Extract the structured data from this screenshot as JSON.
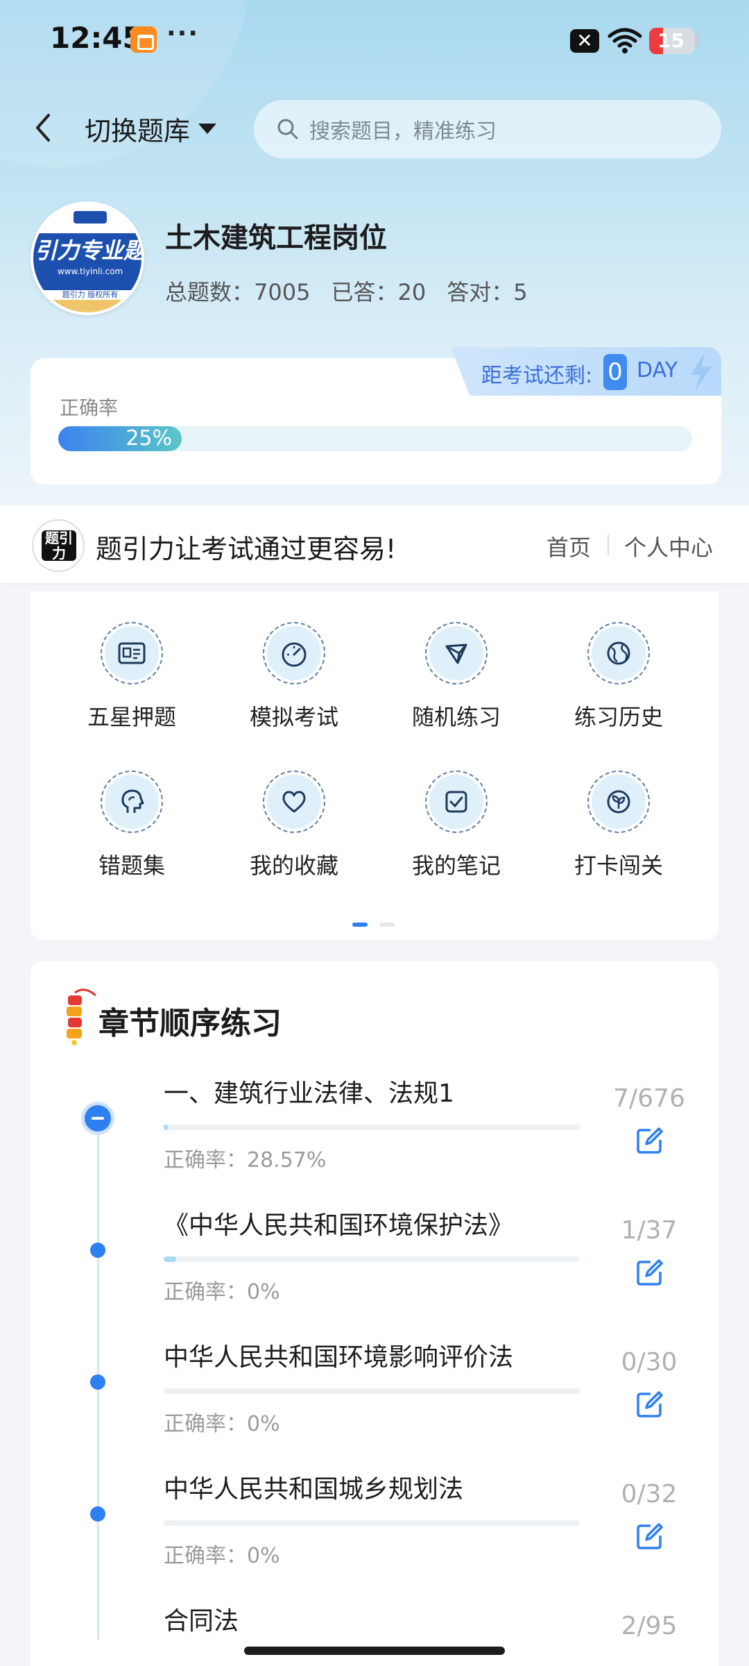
{
  "status_bar": {
    "time": "12:45",
    "dots": "···",
    "x_badge": "✕",
    "battery": "15"
  },
  "header": {
    "switch_label": "切换题库",
    "search_placeholder": "搜索题目，精准练习"
  },
  "bank": {
    "logo_text": "引力专业题",
    "logo_url": "www.tiyinli.com",
    "logo_rights": "题引力 版权所有",
    "title": "土木建筑工程岗位",
    "total_label": "总题数：7005",
    "answered_label": "已答：20",
    "correct_label": "答对：5"
  },
  "accuracy": {
    "label": "正确率",
    "percent_text": "25%",
    "percent": 0.25
  },
  "countdown": {
    "label": "距考试还剩:",
    "days": "0",
    "unit": "DAY"
  },
  "slogan": {
    "logo_text": "题引力",
    "text": "题引力让考试通过更容易!",
    "nav_home": "首页",
    "nav_profile": "个人中心"
  },
  "features": [
    {
      "label": "五星押题",
      "icon": "id-card-icon"
    },
    {
      "label": "模拟考试",
      "icon": "speedometer-icon"
    },
    {
      "label": "随机练习",
      "icon": "network-icon"
    },
    {
      "label": "练习历史",
      "icon": "globe-icon"
    },
    {
      "label": "错题集",
      "icon": "head-icon"
    },
    {
      "label": "我的收藏",
      "icon": "heart-icon"
    },
    {
      "label": "我的笔记",
      "icon": "checklist-icon"
    },
    {
      "label": "打卡闯关",
      "icon": "sprout-icon"
    }
  ],
  "chapter_section": {
    "title": "章节顺序练习",
    "items": [
      {
        "name": "一、建筑行业法律、法规1",
        "rate": "正确率：28.57%",
        "count": "7/676",
        "progress": 0.01
      },
      {
        "name": "《中华人民共和国环境保护法》",
        "rate": "正确率：0%",
        "count": "1/37",
        "progress": 0.03
      },
      {
        "name": "中华人民共和国环境影响评价法",
        "rate": "正确率：0%",
        "count": "0/30",
        "progress": 0
      },
      {
        "name": "中华人民共和国城乡规划法",
        "rate": "正确率：0%",
        "count": "0/32",
        "progress": 0
      },
      {
        "name": "合同法",
        "rate": "",
        "count": "2/95",
        "progress": 0.02
      }
    ]
  },
  "colors": {
    "accent": "#2e7ff0",
    "hero_top": "#a9d8ef",
    "progress_start": "#3b82f0",
    "progress_end": "#5bc6c7"
  }
}
